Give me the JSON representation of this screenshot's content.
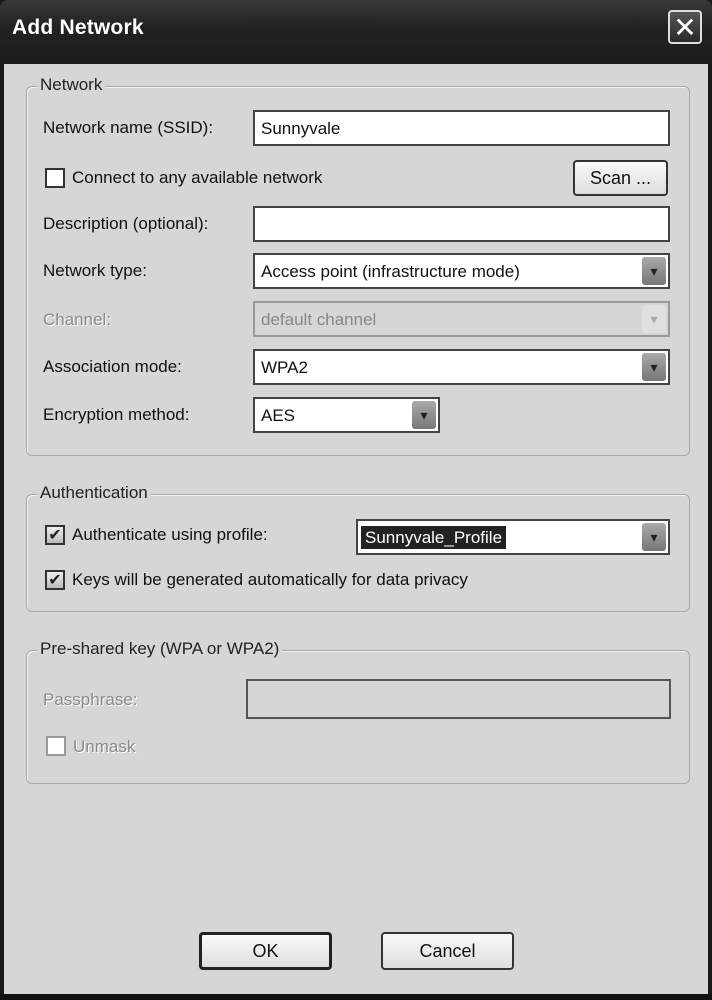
{
  "window": {
    "title": "Add Network",
    "close_label": "✕"
  },
  "network_group": {
    "legend": "Network",
    "ssid_label": "Network name (SSID):",
    "ssid_value": "Sunnyvale",
    "connect_any_label": "Connect to any available network",
    "connect_any_checked": false,
    "scan_label": "Scan ...",
    "description_label": "Description (optional):",
    "description_value": "",
    "network_type_label": "Network type:",
    "network_type_value": "Access point (infrastructure mode)",
    "channel_label": "Channel:",
    "channel_value": "default channel",
    "association_label": "Association mode:",
    "association_value": "WPA2",
    "encryption_label": "Encryption method:",
    "encryption_value": "AES"
  },
  "auth_group": {
    "legend": "Authentication",
    "auth_profile_label": "Authenticate using profile:",
    "auth_profile_checked": true,
    "profile_value": "Sunnyvale_Profile",
    "keys_label": "Keys will be generated automatically for data privacy",
    "keys_checked": true
  },
  "psk_group": {
    "legend": "Pre-shared key (WPA or WPA2)",
    "passphrase_label": "Passphrase:",
    "passphrase_value": "",
    "unmask_label": "Unmask",
    "unmask_checked": false
  },
  "buttons": {
    "ok": "OK",
    "cancel": "Cancel"
  },
  "icons": {
    "check": "✔",
    "dropdown": "▾"
  }
}
